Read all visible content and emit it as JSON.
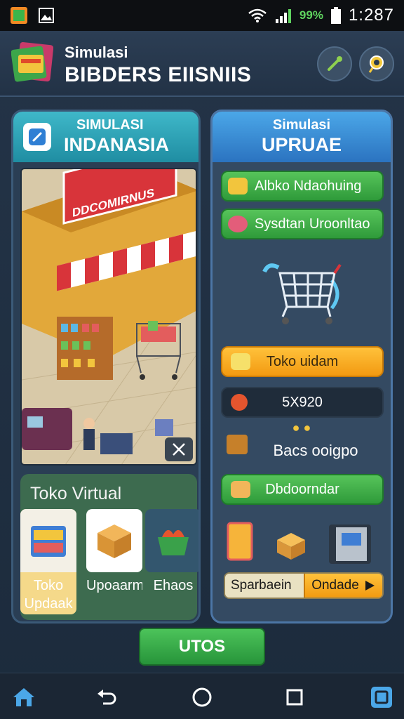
{
  "status_bar": {
    "battery_text": "99%",
    "time": "1:287"
  },
  "header": {
    "small_title": "Simulasi",
    "big_title": "BIBDERS EIISNIIS"
  },
  "left_panel": {
    "title_line1": "SIMULASI",
    "title_line2": "INDANASIA",
    "shop_sign": "DDCOMIRNUS",
    "virtual_title": "Toko Virtual",
    "tiles": [
      {
        "label": "Toko Updaak"
      },
      {
        "label": "Upoaarm"
      },
      {
        "label": "Ehaos"
      }
    ]
  },
  "right_panel": {
    "title_line1": "Simulasi",
    "title_line2": "UPRUAE",
    "btn1": "Albko Ndaohuing",
    "btn2": "Sysdtan Uroonltao",
    "btn3": "Toko uidam",
    "value_display": "5X920",
    "info_label": "Bacs ooigpo",
    "btn4": "Dbdoorndar",
    "progress_label": "Sparbaein",
    "progress_button": "Ondade",
    "progress_value": 0.5
  },
  "bottom_button": "UTOS",
  "colors": {
    "accent_green": "#2f9a3a",
    "accent_orange": "#f29a11",
    "accent_teal": "#1f8da2",
    "accent_blue": "#2b73c0"
  },
  "icons": {
    "home": "home-icon",
    "back": "back-icon",
    "circle": "home-circle-icon",
    "recent": "recent-apps-icon",
    "app": "app-switch-icon"
  }
}
